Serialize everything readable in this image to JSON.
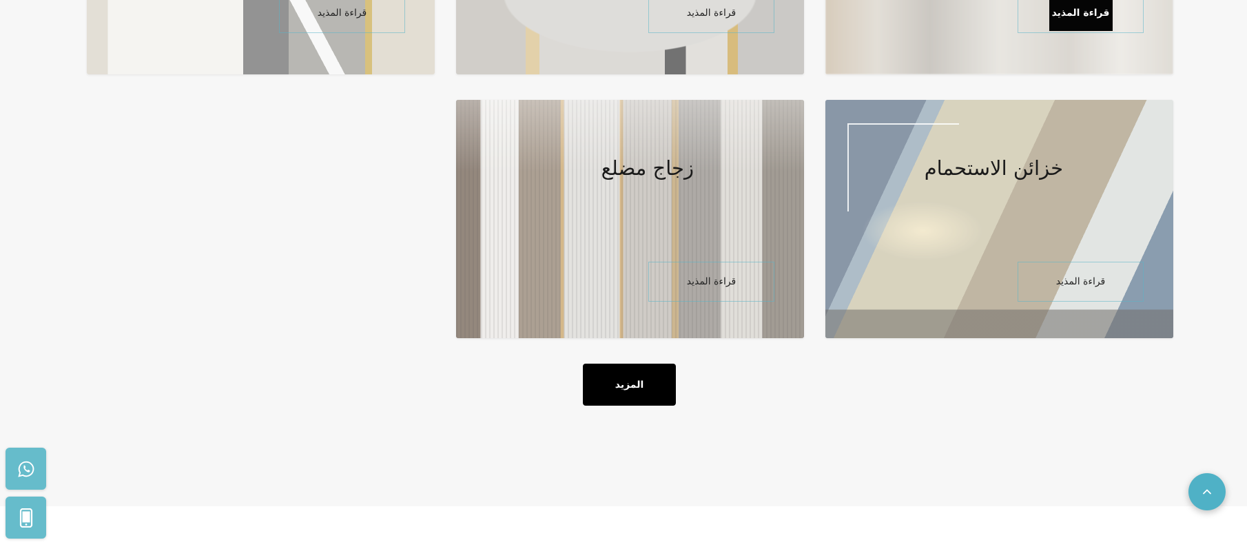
{
  "cards": [
    {
      "id": "top-left",
      "title": "",
      "button": "قراءة المذيد"
    },
    {
      "id": "top-middle",
      "title": "",
      "button": "قراءة المذيد"
    },
    {
      "id": "top-right",
      "title": "",
      "button": "قراءة المذيد"
    },
    {
      "id": "frosted-glass",
      "title": "زجاج مضلع",
      "button": "قراءة المذيد"
    },
    {
      "id": "shower-cabins",
      "title": "خزائن الاستحمام",
      "button": "قراءة المذيد"
    }
  ],
  "more_button": "المزيد",
  "floating": {
    "whatsapp_icon": "whatsapp-icon",
    "phone_icon": "mobile-phone-icon",
    "scroll_top_icon": "chevron-up-icon"
  },
  "colors": {
    "accent": "#66bccb",
    "scroll_top": "#4fb1c6",
    "section_bg": "#f7f7f7",
    "button_dark": "#000000"
  }
}
